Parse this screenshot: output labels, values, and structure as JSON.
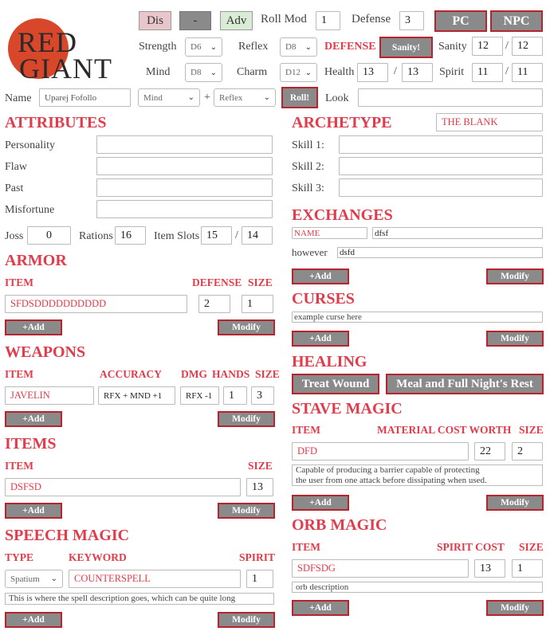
{
  "top": {
    "dis_label": "Dis",
    "neutral_label": "-",
    "adv_label": "Adv",
    "roll_mod_label": "Roll Mod",
    "roll_mod_value": "1",
    "defense_label": "Defense",
    "defense_value": "3",
    "pc_label": "PC",
    "npc_label": "NPC",
    "dis_color": "#e8c6cb",
    "adv_color": "#d9ecd6",
    "accent": "#e03c4b"
  },
  "logo": {
    "line1": "RED",
    "line2": "GIANT",
    "circle_color": "#d9472a"
  },
  "stats": {
    "strength_label": "Strength",
    "strength_die": "D6",
    "reflex_label": "Reflex",
    "reflex_die": "D8",
    "mind_label": "Mind",
    "mind_die": "D8",
    "charm_label": "Charm",
    "charm_die": "D12",
    "defense_label": "DEFENSE",
    "sanity_button": "Sanity!",
    "sanity_label": "Sanity",
    "sanity_current": "12",
    "sanity_max": "12",
    "health_label": "Health",
    "health_current": "13",
    "health_max": "13",
    "spirit_label": "Spirit",
    "spirit_current": "11",
    "spirit_max": "11",
    "slash": "/"
  },
  "name_row": {
    "name_label": "Name",
    "name_value": "Uparej Fofollo",
    "stat1": "Mind",
    "plus": "+",
    "stat2": "Reflex",
    "roll_button": "Roll!",
    "look_label": "Look",
    "look_value": ""
  },
  "attributes": {
    "title": "ATTRIBUTES",
    "fields": [
      {
        "label": "Personality",
        "value": ""
      },
      {
        "label": "Flaw",
        "value": ""
      },
      {
        "label": "Past",
        "value": ""
      },
      {
        "label": "Misfortune",
        "value": ""
      }
    ],
    "joss_label": "Joss",
    "joss_value": "0",
    "rations_label": "Rations",
    "rations_value": "16",
    "item_slots_label": "Item Slots",
    "item_slots_current": "15",
    "item_slots_max": "14"
  },
  "archetype": {
    "title": "ARCHETYPE",
    "value": "THE BLANK",
    "skills": [
      {
        "label": "Skill 1:",
        "value": ""
      },
      {
        "label": "Skill 2:",
        "value": ""
      },
      {
        "label": "Skill 3:",
        "value": ""
      }
    ]
  },
  "armor": {
    "title": "ARMOR",
    "col_item": "ITEM",
    "col_defense": "DEFENSE",
    "col_size": "SIZE",
    "item": "SFDSDDDDDDDDDD",
    "defense": "2",
    "size": "1",
    "add": "+Add",
    "modify": "Modify"
  },
  "weapons": {
    "title": "WEAPONS",
    "col_item": "ITEM",
    "col_accuracy": "ACCURACY",
    "col_dmg": "DMG",
    "col_hands": "HANDS",
    "col_size": "SIZE",
    "item": "JAVELIN",
    "accuracy": "RFX + MND +1",
    "dmg": "RFX -1",
    "hands": "1",
    "size": "3",
    "add": "+Add",
    "modify": "Modify"
  },
  "items": {
    "title": "ITEMS",
    "col_item": "ITEM",
    "col_size": "SIZE",
    "item": "DSFSD",
    "size": "13",
    "add": "+Add",
    "modify": "Modify"
  },
  "speech_magic": {
    "title": "SPEECH MAGIC",
    "col_type": "TYPE",
    "col_keyword": "KEYWORD",
    "col_spirit": "SPIRIT",
    "type": "Spatium",
    "keyword": "COUNTERSPELL",
    "spirit": "1",
    "description": "This is where the spell description goes, which can be quite long",
    "add": "+Add",
    "modify": "Modify"
  },
  "exchanges": {
    "title": "EXCHANGES",
    "name_placeholder": "NAME",
    "name_desc": "dfsf",
    "row_name": "however",
    "row_desc": "dsfd",
    "add": "+Add",
    "modify": "Modify"
  },
  "curses": {
    "title": "CURSES",
    "value": "example curse here",
    "add": "+Add",
    "modify": "Modify"
  },
  "healing": {
    "title": "HEALING",
    "treat_wound": "Treat Wound",
    "meal_rest": "Meal and Full Night's Rest"
  },
  "stave_magic": {
    "title": "STAVE MAGIC",
    "col_item": "ITEM",
    "col_material": "MATERIAL COST WORTH",
    "col_size": "SIZE",
    "item": "DFD",
    "cost": "22",
    "size": "2",
    "description_line1": "Capable of producing a barrier capable of protecting",
    "description_line2": "the user from one attack before dissipating when used.",
    "add": "+Add",
    "modify": "Modify"
  },
  "orb_magic": {
    "title": "ORB MAGIC",
    "col_item": "ITEM",
    "col_spirit_cost": "SPIRIT COST",
    "col_size": "SIZE",
    "item": "SDFSDG",
    "cost": "13",
    "size": "1",
    "description": "orb description",
    "add": "+Add",
    "modify": "Modify"
  }
}
